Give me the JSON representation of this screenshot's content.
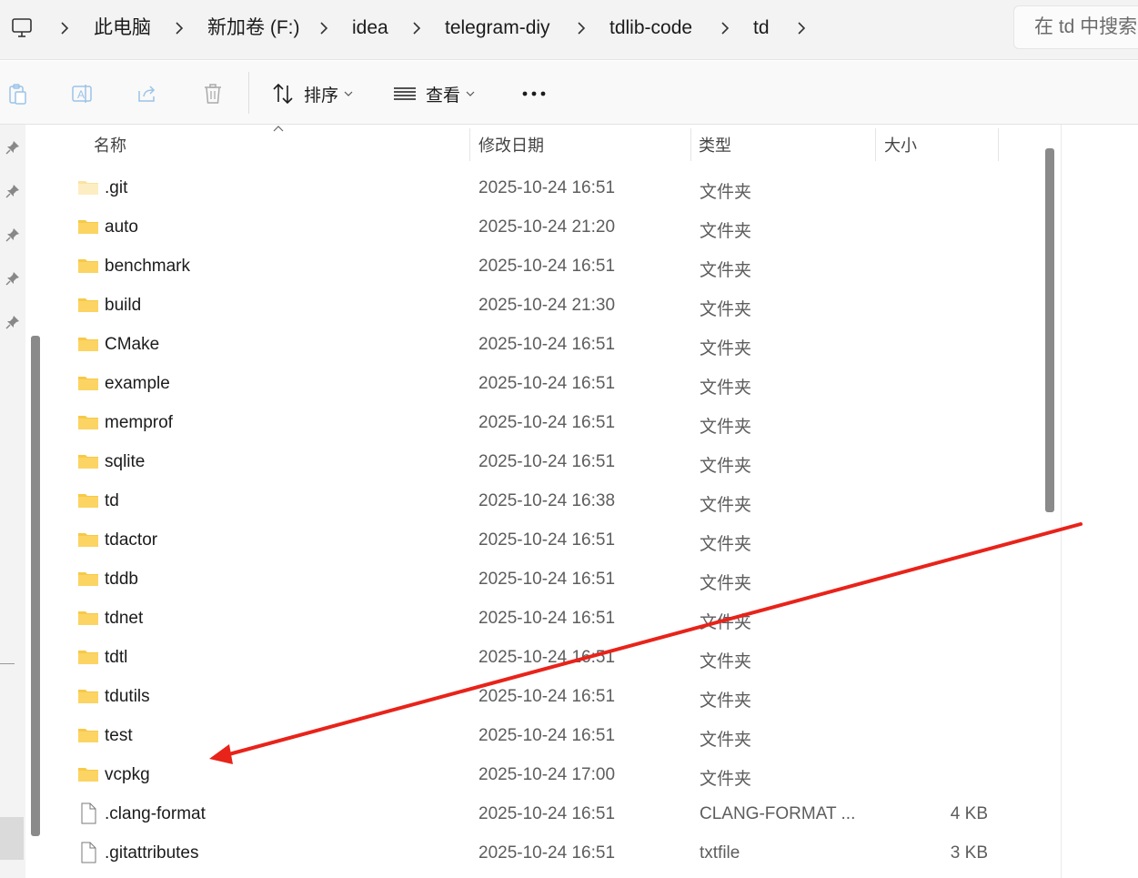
{
  "address": {
    "root_icon": "computer-icon",
    "crumbs": [
      "此电脑",
      "新加卷 (F:)",
      "idea",
      "telegram-diy",
      "tdlib-code",
      "td"
    ],
    "search_placeholder": "在 td 中搜索"
  },
  "toolbar": {
    "copy_icon": "clipboard-icon",
    "rename_icon": "rename-icon",
    "share_icon": "share-icon",
    "delete_icon": "trash-icon",
    "sort_label": "排序",
    "view_label": "查看",
    "more_icon": "more-icon"
  },
  "columns": {
    "name": "名称",
    "modified": "修改日期",
    "type": "类型",
    "size": "大小"
  },
  "files": [
    {
      "name": ".git",
      "modified": "2025-10-24 16:51",
      "type": "文件夹",
      "size": "",
      "icon": "folder-icon"
    },
    {
      "name": "auto",
      "modified": "2025-10-24 21:20",
      "type": "文件夹",
      "size": "",
      "icon": "folder-icon"
    },
    {
      "name": "benchmark",
      "modified": "2025-10-24 16:51",
      "type": "文件夹",
      "size": "",
      "icon": "folder-icon"
    },
    {
      "name": "build",
      "modified": "2025-10-24 21:30",
      "type": "文件夹",
      "size": "",
      "icon": "folder-icon"
    },
    {
      "name": "CMake",
      "modified": "2025-10-24 16:51",
      "type": "文件夹",
      "size": "",
      "icon": "folder-icon"
    },
    {
      "name": "example",
      "modified": "2025-10-24 16:51",
      "type": "文件夹",
      "size": "",
      "icon": "folder-icon"
    },
    {
      "name": "memprof",
      "modified": "2025-10-24 16:51",
      "type": "文件夹",
      "size": "",
      "icon": "folder-icon"
    },
    {
      "name": "sqlite",
      "modified": "2025-10-24 16:51",
      "type": "文件夹",
      "size": "",
      "icon": "folder-icon"
    },
    {
      "name": "td",
      "modified": "2025-10-24 16:38",
      "type": "文件夹",
      "size": "",
      "icon": "folder-icon"
    },
    {
      "name": "tdactor",
      "modified": "2025-10-24 16:51",
      "type": "文件夹",
      "size": "",
      "icon": "folder-icon"
    },
    {
      "name": "tddb",
      "modified": "2025-10-24 16:51",
      "type": "文件夹",
      "size": "",
      "icon": "folder-icon"
    },
    {
      "name": "tdnet",
      "modified": "2025-10-24 16:51",
      "type": "文件夹",
      "size": "",
      "icon": "folder-icon"
    },
    {
      "name": "tdtl",
      "modified": "2025-10-24 16:51",
      "type": "文件夹",
      "size": "",
      "icon": "folder-icon"
    },
    {
      "name": "tdutils",
      "modified": "2025-10-24 16:51",
      "type": "文件夹",
      "size": "",
      "icon": "folder-icon"
    },
    {
      "name": "test",
      "modified": "2025-10-24 16:51",
      "type": "文件夹",
      "size": "",
      "icon": "folder-icon"
    },
    {
      "name": "vcpkg",
      "modified": "2025-10-24 17:00",
      "type": "文件夹",
      "size": "",
      "icon": "folder-icon"
    },
    {
      "name": ".clang-format",
      "modified": "2025-10-24 16:51",
      "type": "CLANG-FORMAT ...",
      "size": "4 KB",
      "icon": "file-icon"
    },
    {
      "name": ".gitattributes",
      "modified": "2025-10-24 16:51",
      "type": "txtfile",
      "size": "3 KB",
      "icon": "file-icon"
    }
  ],
  "annotation": {
    "arrow_color": "#e8231a",
    "points_to": "vcpkg"
  }
}
